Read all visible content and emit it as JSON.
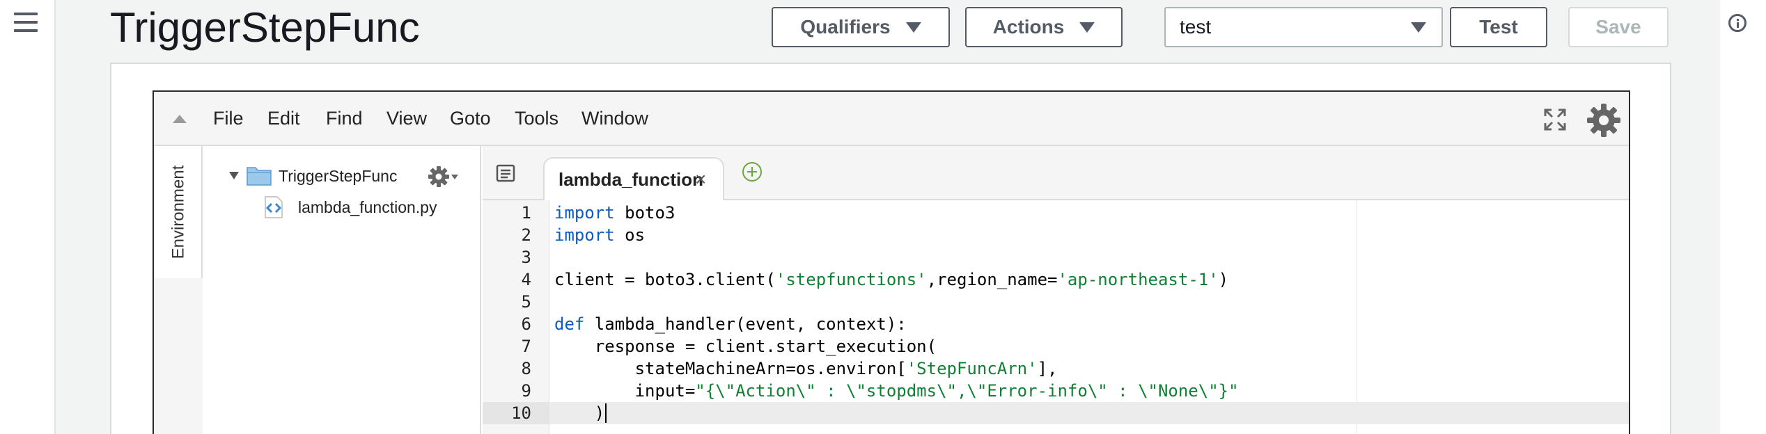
{
  "header": {
    "title": "TriggerStepFunc",
    "qualifiers_label": "Qualifiers",
    "actions_label": "Actions",
    "test_event_value": "test",
    "test_label": "Test",
    "save_label": "Save"
  },
  "ide": {
    "menu": [
      "File",
      "Edit",
      "Find",
      "View",
      "Goto",
      "Tools",
      "Window"
    ],
    "environment_tab_label": "Environment",
    "tree": {
      "folder": "TriggerStepFunc",
      "file": "lambda_function.py"
    },
    "active_tab": "lambda_function",
    "tab_close": "×",
    "line_numbers": [
      "1",
      "2",
      "3",
      "4",
      "5",
      "6",
      "7",
      "8",
      "9",
      "10"
    ],
    "code_lines": [
      [
        {
          "t": "import",
          "c": "kw"
        },
        {
          "t": " boto3"
        }
      ],
      [
        {
          "t": "import",
          "c": "kw"
        },
        {
          "t": " os"
        }
      ],
      [],
      [
        {
          "t": "client = boto3.client("
        },
        {
          "t": "'stepfunctions'",
          "c": "str"
        },
        {
          "t": ",region_name="
        },
        {
          "t": "'ap-northeast-1'",
          "c": "str"
        },
        {
          "t": ")"
        }
      ],
      [],
      [
        {
          "t": "def",
          "c": "kw"
        },
        {
          "t": " lambda_handler(event, context):"
        }
      ],
      [
        {
          "t": "    response = client.start_execution("
        }
      ],
      [
        {
          "t": "        stateMachineArn=os.environ["
        },
        {
          "t": "'StepFuncArn'",
          "c": "str"
        },
        {
          "t": "],"
        }
      ],
      [
        {
          "t": "        input="
        },
        {
          "t": "\"{\\\"Action\\\" : \\\"stopdms\\\",\\\"Error-info\\\" : \\\"None\\\"}\"",
          "c": "str"
        }
      ],
      [
        {
          "t": "    )"
        }
      ]
    ]
  },
  "colors": {
    "keyword": "#0b5cc4",
    "string": "#108035",
    "add_tab": "#69a83a"
  },
  "icons": [
    "hamburger-icon",
    "chevron-down-icon",
    "info-icon",
    "collapse-icon",
    "fullscreen-icon",
    "settings-icon",
    "folder-icon",
    "gear-icon",
    "python-file-icon",
    "tab-list-icon",
    "close-icon",
    "add-tab-icon"
  ]
}
